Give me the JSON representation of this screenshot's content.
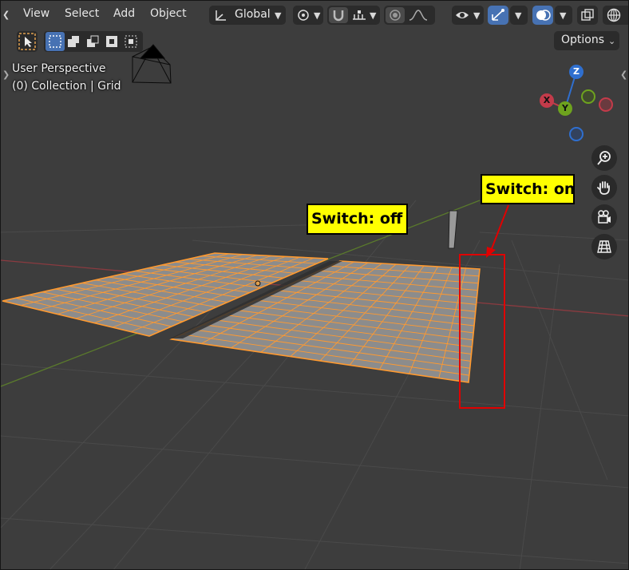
{
  "menus": [
    "View",
    "Select",
    "Add",
    "Object"
  ],
  "header": {
    "transform_orientation": "Global",
    "options_label": "Options"
  },
  "overlay": {
    "perspective": "User Perspective",
    "collection": "(0) Collection | Grid"
  },
  "gizmo": {
    "z_label": "Z",
    "x_label": "X",
    "y_label": "Y"
  },
  "annotations": {
    "switch_off": "Switch: off",
    "switch_on": "Switch: on"
  },
  "colors": {
    "viewport_bg": "#3d3d3d",
    "mesh_fill": "#8c8c8c",
    "wire_selected": "#ff9a30",
    "axis_x": "#c33b4a",
    "axis_y": "#6ea31e",
    "axis_z": "#2f6fcf",
    "callout_bg": "#ffff00",
    "highlight_box": "#e00000",
    "header_active": "#4772b3"
  }
}
